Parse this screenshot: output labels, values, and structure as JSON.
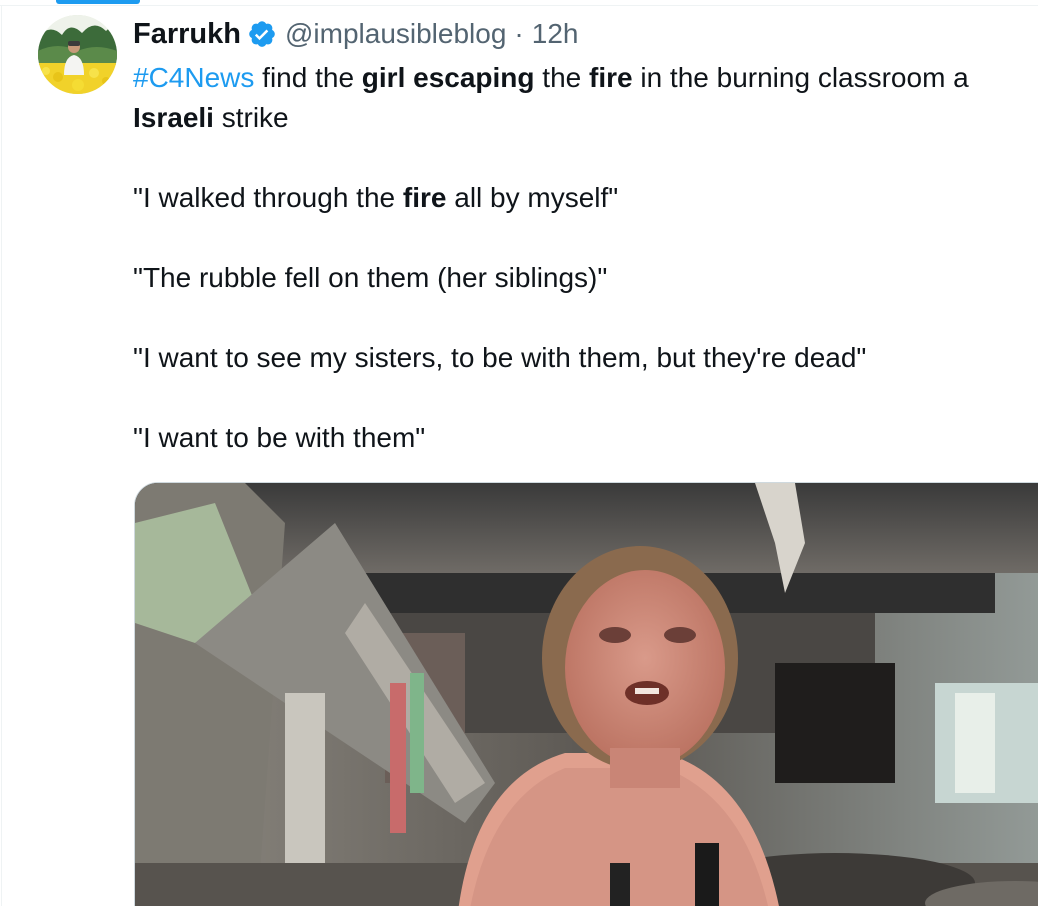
{
  "tweet": {
    "author": {
      "display_name": "Farrukh",
      "handle": "@implausibleblog",
      "verified": true,
      "avatar_icon": "avatar-photo-yellow-flowers"
    },
    "separator": "·",
    "time": "12h",
    "text_lines": [
      {
        "segments": [
          {
            "text": "#C4News",
            "style": "hashtag"
          },
          {
            "text": " find the ",
            "style": "normal"
          },
          {
            "text": "girl escaping",
            "style": "bold"
          },
          {
            "text": " the ",
            "style": "normal"
          },
          {
            "text": "fire",
            "style": "bold"
          },
          {
            "text": " in the burning classroom a",
            "style": "normal"
          }
        ]
      },
      {
        "segments": [
          {
            "text": "Israeli",
            "style": "bold"
          },
          {
            "text": " strike",
            "style": "normal"
          }
        ]
      },
      {
        "segments": [
          {
            "text": "\"I walked through the ",
            "style": "normal"
          },
          {
            "text": "fire",
            "style": "bold"
          },
          {
            "text": " all by myself\"",
            "style": "normal"
          }
        ]
      },
      {
        "segments": [
          {
            "text": "\"The rubble fell on them (her siblings)\"",
            "style": "normal"
          }
        ]
      },
      {
        "segments": [
          {
            "text": "\"I want to see my sisters, to be with them, but they're dead\"",
            "style": "normal"
          }
        ]
      },
      {
        "segments": [
          {
            "text": "\"I want to be with them\"",
            "style": "normal"
          }
        ]
      }
    ],
    "media": {
      "type": "video-thumbnail",
      "description_icon": "photo-girl-in-burned-classroom"
    }
  },
  "colors": {
    "hashtag": "#1d9bf0",
    "verified": "#1d9bf0",
    "secondary_text": "#536471",
    "primary_text": "#0f1419"
  }
}
